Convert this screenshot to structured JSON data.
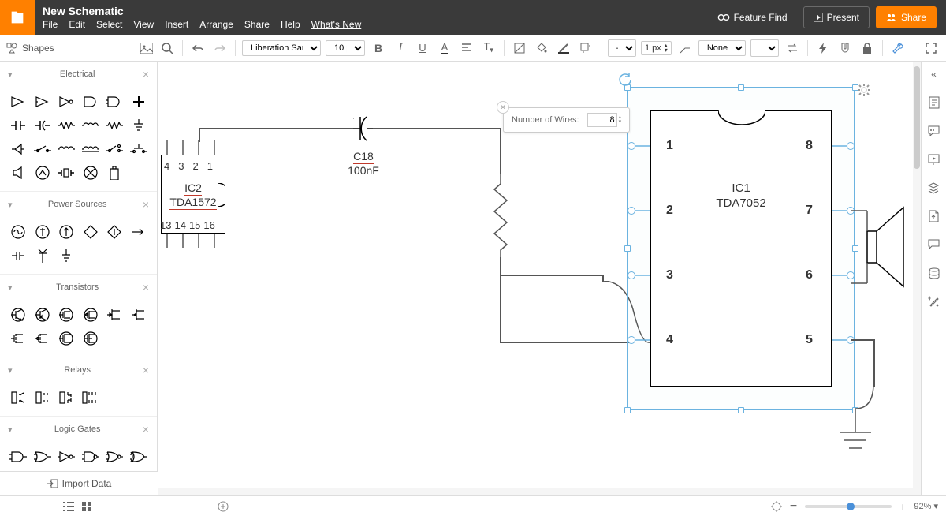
{
  "header": {
    "title": "New Schematic",
    "menu": [
      "File",
      "Edit",
      "Select",
      "View",
      "Insert",
      "Arrange",
      "Share",
      "Help",
      "What's New"
    ],
    "feature_find": "Feature Find",
    "present": "Present",
    "share": "Share"
  },
  "toolbar": {
    "shapes_label": "Shapes",
    "font_name": "Liberation Sans",
    "font_size": "10 pt",
    "line_width": "1 px",
    "line_style": "None",
    "zoom": "92%"
  },
  "left": {
    "categories": [
      "Electrical",
      "Power Sources",
      "Transistors",
      "Relays",
      "Logic Gates"
    ],
    "import": "Import Data"
  },
  "popup": {
    "label": "Number of Wires:",
    "value": "8"
  },
  "schematic": {
    "ic1_name": "IC1",
    "ic1_part": "TDA7052",
    "ic2_name": "IC2",
    "ic2_part": "TDA1572",
    "cap_name": "C18",
    "cap_val": "100nF",
    "ic2_pins_top": [
      "4",
      "3",
      "2",
      "1"
    ],
    "ic2_pins_bot": [
      "13",
      "14",
      "15",
      "16"
    ],
    "ic1_pins_left": [
      "1",
      "2",
      "3",
      "4"
    ],
    "ic1_pins_right": [
      "8",
      "7",
      "6",
      "5"
    ]
  },
  "footer": {
    "zoom_label": "92%"
  }
}
